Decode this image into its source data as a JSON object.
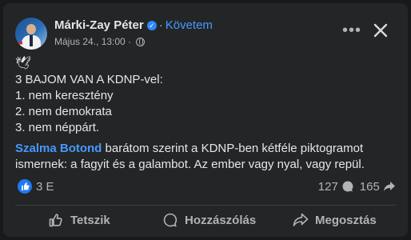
{
  "post": {
    "author_name": "Márki-Zay Péter",
    "separator": "·",
    "follow_label": "Követem",
    "timestamp": "Május 24., 13:00 ·",
    "emoji": "🕊",
    "lines": [
      "3 BAJOM VAN A KDNP-vel:",
      "1. nem keresztény",
      "2. nem demokrata",
      "3. nem néppárt."
    ],
    "mention": "Szalma Botond",
    "paragraph_line1_rest": " barátom szerint a KDNP-ben kétféle piktogramot",
    "paragraph_line2": "ismernek: a fagyit és a galambot. Az ember vagy nyal, vagy repül."
  },
  "stats": {
    "reactions": "3 E",
    "comments": "127",
    "shares": "165"
  },
  "actions": {
    "like": "Tetszik",
    "comment": "Hozzászólás",
    "share": "Megosztás"
  },
  "colors": {
    "background": "#242526",
    "text": "#e4e6eb",
    "secondary_text": "#b0b3b8",
    "accent": "#4599ff",
    "like_blue": "#2078f4"
  }
}
